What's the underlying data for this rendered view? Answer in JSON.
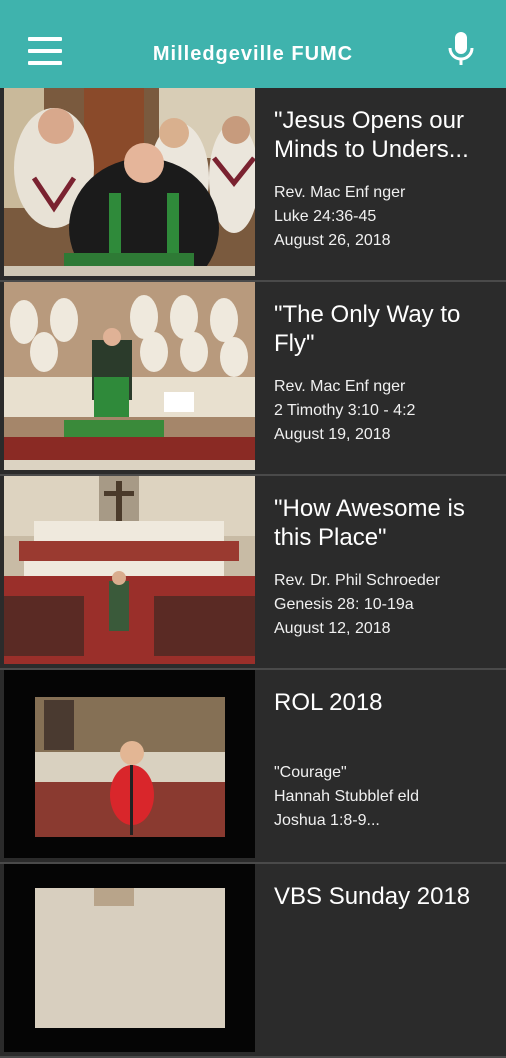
{
  "header": {
    "title": "Milledgeville FUMC",
    "menu_icon": "hamburger-menu-icon",
    "mic_icon": "microphone-icon",
    "bg_color": "#3fb3ad"
  },
  "sermons": [
    {
      "title": "\"Jesus Opens our Minds to Unders...",
      "line1": "Rev. Mac Enf nger",
      "line2": "Luke 24:36-45",
      "line3": "August 26, 2018"
    },
    {
      "title": "\"The Only Way to Fly\"",
      "line1": "Rev. Mac Enf nger",
      "line2": "2 Timothy 3:10 - 4:2",
      "line3": "August 19, 2018"
    },
    {
      "title": "\"How Awesome is this Place\"",
      "line1": "Rev. Dr. Phil Schroeder",
      "line2": "Genesis 28: 10-19a",
      "line3": "August 12, 2018"
    },
    {
      "title": "ROL 2018",
      "line1": "\"Courage\"",
      "line2": "Hannah Stubblef eld",
      "line3": "Joshua 1:8-9..."
    },
    {
      "title": "VBS Sunday 2018",
      "line1": "",
      "line2": "",
      "line3": ""
    }
  ]
}
